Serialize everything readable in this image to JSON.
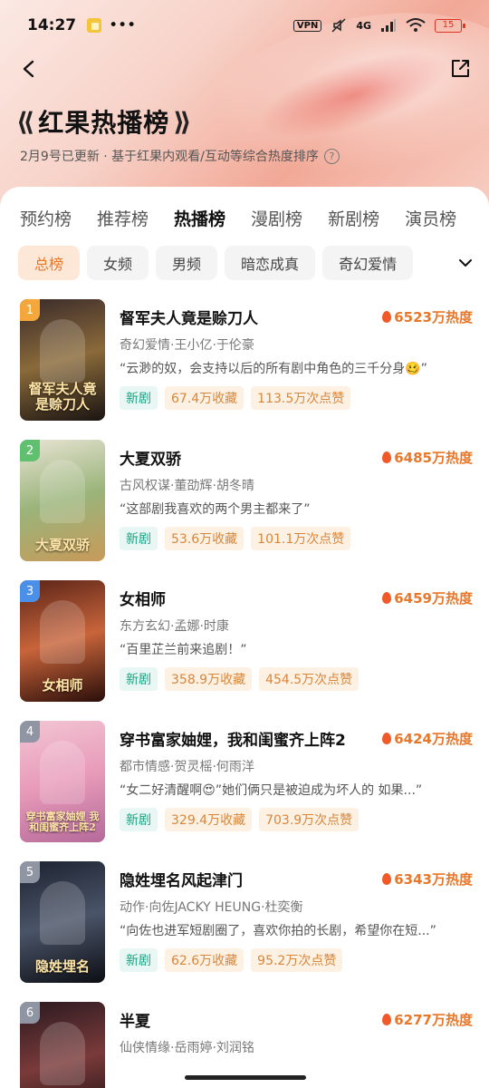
{
  "status_bar": {
    "time": "14:27",
    "dots": "•••",
    "vpn": "VPN",
    "network": "4G",
    "battery": "15"
  },
  "header": {
    "title": "红果热播榜",
    "subtitle": "2月9号已更新 · 基于红果内观看/互动等综合热度排序",
    "help": "?"
  },
  "tabs": [
    {
      "label": "预约榜",
      "active": false
    },
    {
      "label": "推荐榜",
      "active": false
    },
    {
      "label": "热播榜",
      "active": true
    },
    {
      "label": "漫剧榜",
      "active": false
    },
    {
      "label": "新剧榜",
      "active": false
    },
    {
      "label": "演员榜",
      "active": false
    }
  ],
  "chips": [
    {
      "label": "总榜",
      "active": true
    },
    {
      "label": "女频",
      "active": false
    },
    {
      "label": "男频",
      "active": false
    },
    {
      "label": "暗恋成真",
      "active": false
    },
    {
      "label": "奇幻爱情",
      "active": false
    }
  ],
  "list": [
    {
      "rank": "1",
      "title": "督军夫人竟是赊刀人",
      "heat": "6523万热度",
      "meta": "奇幻爱情·王小亿·于伦豪",
      "quote": "“云渺的奴，会支持以后的所有剧中角色的三千分身🥴”",
      "tags": [
        "新剧",
        "67.4万收藏",
        "113.5万次点赞"
      ],
      "poster_text": "督军夫人竟是赊刀人",
      "badge_color": "#f4a73a",
      "poster_colors": [
        "#3a2a2a",
        "#8a6a3a",
        "#1a1412"
      ]
    },
    {
      "rank": "2",
      "title": "大夏双骄",
      "heat": "6485万热度",
      "meta": "古风权谋·董劭辉·胡冬晴",
      "quote": "“这部剧我喜欢的两个男主都来了”",
      "tags": [
        "新剧",
        "53.6万收藏",
        "101.1万次点赞"
      ],
      "poster_text": "大夏双骄",
      "badge_color": "#5fc06f",
      "poster_colors": [
        "#e8e4d4",
        "#9ab47a",
        "#c89a5a"
      ]
    },
    {
      "rank": "3",
      "title": "女相师",
      "heat": "6459万热度",
      "meta": "东方玄幻·孟娜·时康",
      "quote": "“百里芷兰前来追剧！”",
      "tags": [
        "新剧",
        "358.9万收藏",
        "454.5万次点赞"
      ],
      "poster_text": "女相师",
      "badge_color": "#4a8fe8",
      "poster_colors": [
        "#5a2418",
        "#c8643a",
        "#2a0e0a"
      ]
    },
    {
      "rank": "4",
      "title": "穿书富家妯娌，我和闺蜜齐上阵2",
      "heat": "6424万热度",
      "meta": "都市情感·贺灵榣·何雨洋",
      "quote": "“女二好清醒啊😍”她们俩只是被迫成为坏人的 如果...”",
      "tags": [
        "新剧",
        "329.4万收藏",
        "703.9万次点赞"
      ],
      "poster_text": "穿书富家妯娌 我和闺蜜齐上阵2",
      "badge_color": "#8f95a3",
      "poster_colors": [
        "#f2c6d4",
        "#e89ab8",
        "#b46a9a"
      ]
    },
    {
      "rank": "5",
      "title": "隐姓埋名风起津门",
      "heat": "6343万热度",
      "meta": "动作·向佐JACKY HEUNG·杜奕衡",
      "quote": "“向佐也进军短剧圈了，喜欢你拍的长剧，希望你在短...”",
      "tags": [
        "新剧",
        "62.6万收藏",
        "95.2万次点赞"
      ],
      "poster_text": "隐姓埋名",
      "badge_color": "#8f95a3",
      "poster_colors": [
        "#1c2230",
        "#4a5468",
        "#0c0e14"
      ]
    },
    {
      "rank": "6",
      "title": "半夏",
      "heat": "6277万热度",
      "meta": "仙侠情缘·岳雨婷·刘润铭",
      "quote": "",
      "tags": [],
      "poster_text": "",
      "badge_color": "#8f95a3",
      "poster_colors": [
        "#2a1a20",
        "#7a3a3a",
        "#1a0e10"
      ]
    }
  ]
}
